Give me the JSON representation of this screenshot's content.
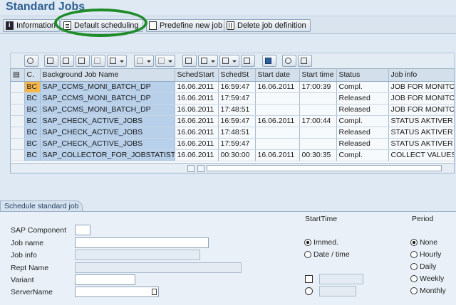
{
  "title": "Standard Jobs",
  "toolbar": {
    "information_label": "Information",
    "default_scheduling_label": "Default scheduling",
    "predefine_label": "Predefine new job",
    "delete_label": "Delete job definition"
  },
  "grid": {
    "columns": [
      "C.",
      "Background Job Name",
      "SchedStart",
      "SchedSt",
      "Start date",
      "Start time",
      "Status",
      "Job info"
    ],
    "rows": [
      [
        "BC",
        "SAP_CCMS_MONI_BATCH_DP",
        "16.06.2011",
        "16:59:47",
        "16.06.2011",
        "17:00:39",
        "Compl.",
        "JOB FOR MONITO"
      ],
      [
        "BC",
        "SAP_CCMS_MONI_BATCH_DP",
        "16.06.2011",
        "17:59:47",
        "",
        "",
        "Released",
        "JOB FOR MONITO"
      ],
      [
        "BC",
        "SAP_CCMS_MONI_BATCH_DP",
        "16.06.2011",
        "17:48:51",
        "",
        "",
        "Released",
        "JOB FOR MONITO"
      ],
      [
        "BC",
        "SAP_CHECK_ACTIVE_JOBS",
        "16.06.2011",
        "16:59:47",
        "16.06.2011",
        "17:00:44",
        "Compl.",
        "STATUS AKTIVER"
      ],
      [
        "BC",
        "SAP_CHECK_ACTIVE_JOBS",
        "16.06.2011",
        "17:48:51",
        "",
        "",
        "Released",
        "STATUS AKTIVER"
      ],
      [
        "BC",
        "SAP_CHECK_ACTIVE_JOBS",
        "16.06.2011",
        "17:59:47",
        "",
        "",
        "Released",
        "STATUS AKTIVER"
      ],
      [
        "BC",
        "SAP_COLLECTOR_FOR_JOBSTATISTIC",
        "16.06.2011",
        "00:30:00",
        "16.06.2011",
        "00:30:35",
        "Compl.",
        "COLLECT VALUES"
      ]
    ]
  },
  "panel": {
    "tab_label": "Schedule standard job",
    "sap_component_label": "SAP Component",
    "job_name_label": "Job name",
    "job_info_label": "Job info",
    "rept_name_label": "Rept Name",
    "variant_label": "Variant",
    "server_name_label": "ServerName",
    "start_time_heading": "StartTime",
    "immed_label": "Immed.",
    "date_time_label": "Date / time",
    "period_heading": "Period",
    "periods": [
      "None",
      "Hourly",
      "Daily",
      "Weekly",
      "Monthly"
    ]
  }
}
